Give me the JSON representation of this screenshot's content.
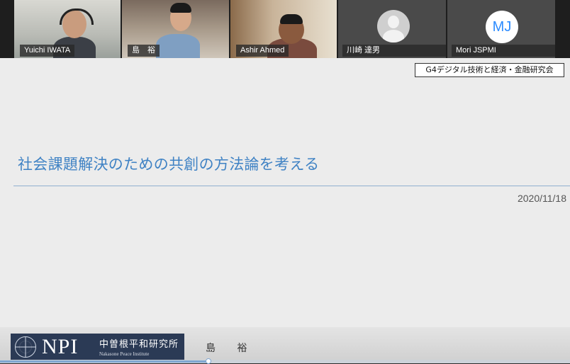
{
  "participants": [
    {
      "name": "Yuichi IWATA",
      "type": "video"
    },
    {
      "name": "島　裕",
      "type": "video"
    },
    {
      "name": "Ashir Ahmed",
      "type": "video"
    },
    {
      "name": "川崎 達男",
      "type": "avatar-default"
    },
    {
      "name": "Mori JSPMI",
      "type": "avatar-initials",
      "initials": "MJ"
    }
  ],
  "slide": {
    "group_tag": "G4デジタル技術と経済・金融研究会",
    "title": "社会課題解決のための共創の方法論を考える",
    "date": "2020/11/18"
  },
  "footer": {
    "logo_text": "NPI",
    "org_name_jp": "中曽根平和研究所",
    "org_name_en": "Nakasone Peace Institute",
    "presenter": "島 裕"
  },
  "playback": {
    "progress": 0.366
  },
  "colors": {
    "title": "#3f82c4",
    "accent_blue": "#2d8cff",
    "logo_bg": "#2b3a55"
  }
}
